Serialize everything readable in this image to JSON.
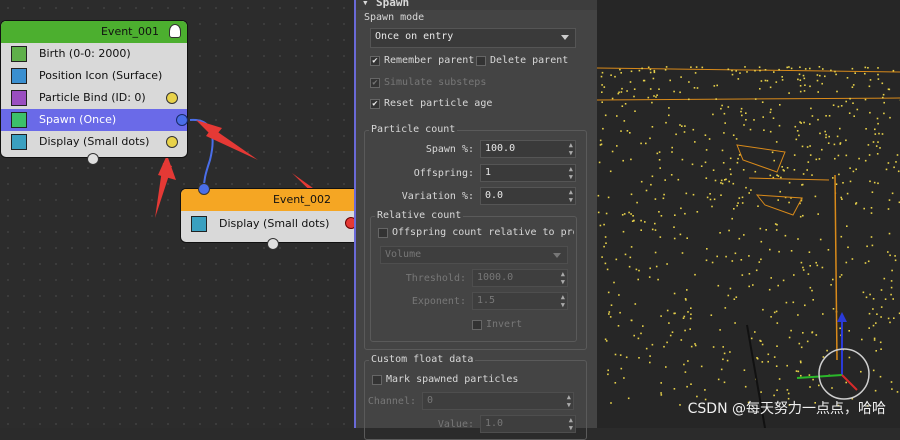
{
  "graph": {
    "event1": {
      "title": "Event_001",
      "header_color": "#4caf2f",
      "operators": [
        {
          "label": "Birth (0-0: 2000)",
          "icon": "birth-icon",
          "selected": false
        },
        {
          "label": "Position Icon (Surface)",
          "icon": "position-icon",
          "selected": false
        },
        {
          "label": "Particle Bind (ID: 0)",
          "icon": "bind-icon",
          "selected": false
        },
        {
          "label": "Spawn (Once)",
          "icon": "spawn-icon",
          "selected": true
        },
        {
          "label": "Display (Small dots)",
          "icon": "display-icon",
          "selected": false
        }
      ]
    },
    "event2": {
      "title": "Event_002",
      "header_color": "#f5a623",
      "operators": [
        {
          "label": "Display (Small dots)",
          "icon": "display-icon"
        }
      ]
    },
    "accent_color": "#6a6ae8"
  },
  "panel": {
    "rollout_title": "Spawn",
    "spawn_mode": {
      "title": "Spawn mode",
      "dropdown_value": "Once on entry",
      "remember_parent": "Remember parent",
      "delete_parent": "Delete parent",
      "simulate_substeps": "Simulate substeps",
      "reset_particle_age": "Reset particle age"
    },
    "particle_count": {
      "title": "Particle count",
      "spawn_label": "Spawn %:",
      "spawn_value": "100.0",
      "offspring_label": "Offspring:",
      "offspring_value": "1",
      "variation_label": "Variation %:",
      "variation_value": "0.0",
      "relative_count": {
        "title": "Relative count",
        "offspring_relative": "Offspring count relative to prop",
        "volume_dropdown": "Volume",
        "threshold_label": "Threshold:",
        "threshold_value": "1000.0",
        "exponent_label": "Exponent:",
        "exponent_value": "1.5",
        "invert": "Invert"
      }
    },
    "custom_float": {
      "title": "Custom float data",
      "mark_spawned": "Mark spawned particles",
      "channel_label": "Channel:",
      "channel_value": "0",
      "value_label": "Value:",
      "value_value": "1.0"
    }
  },
  "viewport": {
    "watermark": "CSDN @每天努力一点点，哈哈",
    "particle_color": "#e8d24a"
  }
}
